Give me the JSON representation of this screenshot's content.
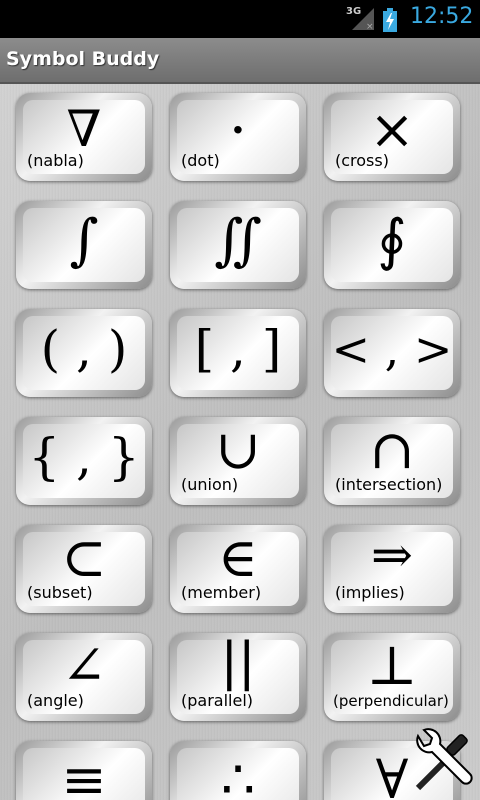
{
  "status_bar": {
    "network": "3G",
    "time": "12:52"
  },
  "app": {
    "title": "Symbol Buddy"
  },
  "symbols": [
    {
      "symbol": "∇",
      "label": "(nabla)"
    },
    {
      "symbol": "·",
      "label": "(dot)"
    },
    {
      "symbol": "×",
      "label": "(cross)"
    },
    {
      "symbol": "∫",
      "label": ""
    },
    {
      "symbol": "∬",
      "label": ""
    },
    {
      "symbol": "∮",
      "label": ""
    },
    {
      "symbol": "( , )",
      "label": ""
    },
    {
      "symbol": "[ , ]",
      "label": ""
    },
    {
      "symbol": "< , >",
      "label": ""
    },
    {
      "symbol": "{ , }",
      "label": ""
    },
    {
      "symbol": "∪",
      "label": "(union)"
    },
    {
      "symbol": "∩",
      "label": "(intersection)"
    },
    {
      "symbol": "⊂",
      "label": "(subset)"
    },
    {
      "symbol": "∈",
      "label": "(member)"
    },
    {
      "symbol": "⇒",
      "label": "(implies)"
    },
    {
      "symbol": "∠",
      "label": "(angle)"
    },
    {
      "symbol": "||",
      "label": "(parallel)"
    },
    {
      "symbol": "⊥",
      "label": "(perpendicular)"
    },
    {
      "symbol": "≡",
      "label": ""
    },
    {
      "symbol": "∴",
      "label": ""
    },
    {
      "symbol": "∀",
      "label": ""
    }
  ],
  "icons": {
    "signal": "signal-icon",
    "battery": "battery-charging-icon",
    "tools": "wrench-screwdriver-icon"
  }
}
